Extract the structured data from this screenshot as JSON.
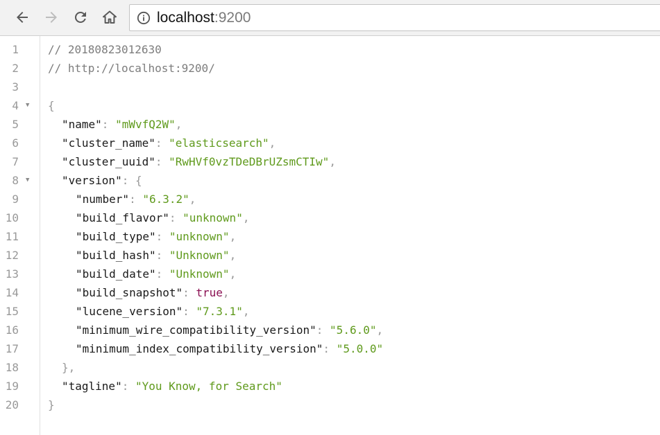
{
  "browser": {
    "url_host": "localhost",
    "url_port": ":9200"
  },
  "code_lines": [
    {
      "n": "1",
      "indent": 0,
      "parts": [
        {
          "t": "// 20180823012630",
          "c": "comment"
        }
      ]
    },
    {
      "n": "2",
      "indent": 0,
      "parts": [
        {
          "t": "// http://localhost:9200/",
          "c": "comment"
        }
      ]
    },
    {
      "n": "3",
      "indent": 0,
      "parts": []
    },
    {
      "n": "4",
      "indent": 0,
      "fold": true,
      "parts": [
        {
          "t": "{",
          "c": "punct"
        }
      ]
    },
    {
      "n": "5",
      "indent": 1,
      "parts": [
        {
          "t": "\"name\"",
          "c": "key"
        },
        {
          "t": ": ",
          "c": "punct"
        },
        {
          "t": "\"mWvfQ2W\"",
          "c": "str"
        },
        {
          "t": ",",
          "c": "punct"
        }
      ]
    },
    {
      "n": "6",
      "indent": 1,
      "parts": [
        {
          "t": "\"cluster_name\"",
          "c": "key"
        },
        {
          "t": ": ",
          "c": "punct"
        },
        {
          "t": "\"elasticsearch\"",
          "c": "str"
        },
        {
          "t": ",",
          "c": "punct"
        }
      ]
    },
    {
      "n": "7",
      "indent": 1,
      "parts": [
        {
          "t": "\"cluster_uuid\"",
          "c": "key"
        },
        {
          "t": ": ",
          "c": "punct"
        },
        {
          "t": "\"RwHVf0vzTDeDBrUZsmCTIw\"",
          "c": "str"
        },
        {
          "t": ",",
          "c": "punct"
        }
      ]
    },
    {
      "n": "8",
      "indent": 1,
      "fold": true,
      "parts": [
        {
          "t": "\"version\"",
          "c": "key"
        },
        {
          "t": ": {",
          "c": "punct"
        }
      ]
    },
    {
      "n": "9",
      "indent": 2,
      "parts": [
        {
          "t": "\"number\"",
          "c": "key"
        },
        {
          "t": ": ",
          "c": "punct"
        },
        {
          "t": "\"6.3.2\"",
          "c": "str"
        },
        {
          "t": ",",
          "c": "punct"
        }
      ]
    },
    {
      "n": "10",
      "indent": 2,
      "parts": [
        {
          "t": "\"build_flavor\"",
          "c": "key"
        },
        {
          "t": ": ",
          "c": "punct"
        },
        {
          "t": "\"unknown\"",
          "c": "str"
        },
        {
          "t": ",",
          "c": "punct"
        }
      ]
    },
    {
      "n": "11",
      "indent": 2,
      "parts": [
        {
          "t": "\"build_type\"",
          "c": "key"
        },
        {
          "t": ": ",
          "c": "punct"
        },
        {
          "t": "\"unknown\"",
          "c": "str"
        },
        {
          "t": ",",
          "c": "punct"
        }
      ]
    },
    {
      "n": "12",
      "indent": 2,
      "parts": [
        {
          "t": "\"build_hash\"",
          "c": "key"
        },
        {
          "t": ": ",
          "c": "punct"
        },
        {
          "t": "\"Unknown\"",
          "c": "str"
        },
        {
          "t": ",",
          "c": "punct"
        }
      ]
    },
    {
      "n": "13",
      "indent": 2,
      "parts": [
        {
          "t": "\"build_date\"",
          "c": "key"
        },
        {
          "t": ": ",
          "c": "punct"
        },
        {
          "t": "\"Unknown\"",
          "c": "str"
        },
        {
          "t": ",",
          "c": "punct"
        }
      ]
    },
    {
      "n": "14",
      "indent": 2,
      "parts": [
        {
          "t": "\"build_snapshot\"",
          "c": "key"
        },
        {
          "t": ": ",
          "c": "punct"
        },
        {
          "t": "true",
          "c": "bool"
        },
        {
          "t": ",",
          "c": "punct"
        }
      ]
    },
    {
      "n": "15",
      "indent": 2,
      "parts": [
        {
          "t": "\"lucene_version\"",
          "c": "key"
        },
        {
          "t": ": ",
          "c": "punct"
        },
        {
          "t": "\"7.3.1\"",
          "c": "str"
        },
        {
          "t": ",",
          "c": "punct"
        }
      ]
    },
    {
      "n": "16",
      "indent": 2,
      "parts": [
        {
          "t": "\"minimum_wire_compatibility_version\"",
          "c": "key"
        },
        {
          "t": ": ",
          "c": "punct"
        },
        {
          "t": "\"5.6.0\"",
          "c": "str"
        },
        {
          "t": ",",
          "c": "punct"
        }
      ]
    },
    {
      "n": "17",
      "indent": 2,
      "parts": [
        {
          "t": "\"minimum_index_compatibility_version\"",
          "c": "key"
        },
        {
          "t": ": ",
          "c": "punct"
        },
        {
          "t": "\"5.0.0\"",
          "c": "str"
        }
      ]
    },
    {
      "n": "18",
      "indent": 1,
      "parts": [
        {
          "t": "},",
          "c": "punct"
        }
      ]
    },
    {
      "n": "19",
      "indent": 1,
      "parts": [
        {
          "t": "\"tagline\"",
          "c": "key"
        },
        {
          "t": ": ",
          "c": "punct"
        },
        {
          "t": "\"You Know, for Search\"",
          "c": "str"
        }
      ]
    },
    {
      "n": "20",
      "indent": 0,
      "parts": [
        {
          "t": "}",
          "c": "punct"
        }
      ]
    }
  ],
  "colors": {
    "string": "#5f9a1c",
    "boolean": "#8a0f52",
    "comment": "#7d7d7d",
    "line_number": "#999999"
  },
  "icons": {
    "back": "arrow-left-icon",
    "forward": "arrow-right-icon",
    "reload": "reload-icon",
    "home": "home-icon",
    "info": "info-circle-icon",
    "fold": "fold-triangle-icon"
  }
}
